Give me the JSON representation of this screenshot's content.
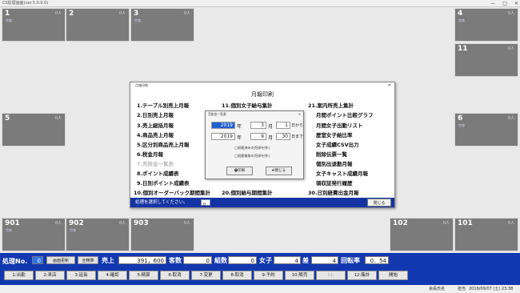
{
  "window": {
    "title": "CS処理画面(ver.5.0.0.0)",
    "buttons": [
      "—",
      "□",
      "✕"
    ]
  },
  "tiles": [
    {
      "num": "1",
      "count": "0人",
      "sub": "空席",
      "pos": "t1"
    },
    {
      "num": "2",
      "count": "0人",
      "sub": "",
      "pos": "t2"
    },
    {
      "num": "3",
      "count": "0人",
      "sub": "空席",
      "pos": "t3"
    },
    {
      "num": "4",
      "count": "0人",
      "sub": "空席",
      "pos": "t4"
    },
    {
      "num": "11",
      "count": "0人",
      "sub": "",
      "pos": "t5"
    },
    {
      "num": "5",
      "count": "0人",
      "sub": "",
      "pos": "t6"
    },
    {
      "num": "6",
      "count": "0人",
      "sub": "空席",
      "pos": "t7"
    },
    {
      "num": "901",
      "count": "0人",
      "sub": "空席",
      "pos": "t8"
    },
    {
      "num": "902",
      "count": "0人",
      "sub": "空席",
      "pos": "t9"
    },
    {
      "num": "903",
      "count": "0人",
      "sub": "",
      "pos": "t10"
    },
    {
      "num": "102",
      "count": "0人",
      "sub": "",
      "pos": "t11"
    },
    {
      "num": "101",
      "count": "0人",
      "sub": "",
      "pos": "t12"
    }
  ],
  "dialog": {
    "title": "月報印刷",
    "heading": "月報印刷",
    "items": [
      "1.テーブル別売上月報",
      "2.日別売上月報",
      "3.売上総括月報",
      "4.商品売上月報",
      "5.区分別商品売上月報",
      "6.税金月報",
      "7.売掛金一覧表",
      "8.ポイント成績表",
      "9.日別ポイント成績表",
      "10.個別オーダーバック期間集計",
      "11.個別女子給与集計",
      "20.個別給与期間集計",
      "21.案内所売上集計",
      "月間ポイント比較グラフ",
      "月間女子出勤リスト",
      "歴室女子給比率",
      "女子成績CSV出力",
      "削除伝票一覧",
      "個別出退勤月報",
      "女子キャスト成績月報",
      "領収証発行履歴",
      "30.日別経費出金月報"
    ],
    "footer_text": "処理を選択してください。",
    "footer_input": "0",
    "close_label": "閉じる"
  },
  "subdialog": {
    "title": "売掛金一覧表",
    "from": {
      "year": "2019",
      "month": "3",
      "day": "1",
      "suffix": "日から"
    },
    "to": {
      "year": "2019",
      "month": "9",
      "day": "30",
      "suffix": "日まで"
    },
    "unit_year": "年",
    "unit_month": "月",
    "check1": "□退客済みの売掛を除く",
    "check2": "□退客後取の売掛を除く",
    "print_label": "印刷",
    "close_label": "閉じる"
  },
  "status": {
    "label_no": "処理No.",
    "no_value": "0",
    "refresh": "画面更新",
    "settle": "全精算",
    "sales_label": "売上",
    "sales_value": "391，600",
    "guests_label": "客数",
    "guests_value": "0",
    "groups_label": "組数",
    "groups_value": "0",
    "women_label": "女子",
    "women_value": "4",
    "diff_label": "差",
    "diff_value": "4",
    "rotation_label": "回転率",
    "rotation_value": "0．54"
  },
  "fkeys": [
    "1:出勤",
    "2:来店",
    "3:延長",
    "4:確認",
    "5:精算",
    "6:取消",
    "7:変更",
    "8:取消",
    "9:予約",
    "10:販売",
    "11:",
    "12:集計",
    "開始"
  ],
  "bottom": {
    "left": "会員氏名",
    "mid": "担当",
    "date": "2019/09/07 (土) 23:38"
  }
}
